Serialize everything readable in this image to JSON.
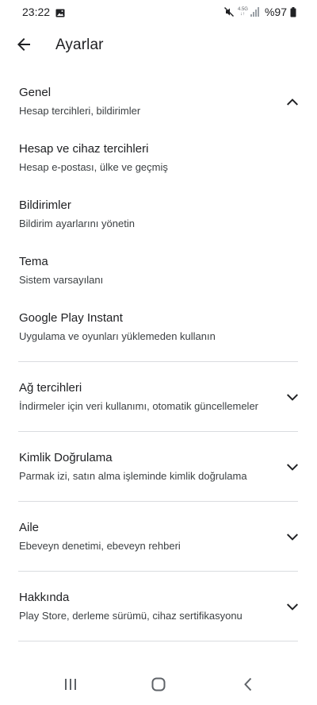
{
  "status_bar": {
    "time": "23:22",
    "network_top": "4.5G",
    "network_bottom": "↓↑",
    "battery": "%97"
  },
  "app_bar": {
    "title": "Ayarlar"
  },
  "settings": [
    {
      "title": "Genel",
      "subtitle": "Hesap tercihleri, bildirimler",
      "expanded": true
    },
    {
      "title": "Hesap ve cihaz tercihleri",
      "subtitle": "Hesap e-postası, ülke ve geçmiş"
    },
    {
      "title": "Bildirimler",
      "subtitle": "Bildirim ayarlarını yönetin"
    },
    {
      "title": "Tema",
      "subtitle": "Sistem varsayılanı"
    },
    {
      "title": "Google Play Instant",
      "subtitle": "Uygulama ve oyunları yüklemeden kullanın"
    },
    {
      "title": "Ağ tercihleri",
      "subtitle": "İndirmeler için veri kullanımı, otomatik güncellemeler",
      "expanded": false
    },
    {
      "title": "Kimlik Doğrulama",
      "subtitle": "Parmak izi, satın alma işleminde kimlik doğrulama",
      "expanded": false
    },
    {
      "title": "Aile",
      "subtitle": "Ebeveyn denetimi, ebeveyn rehberi",
      "expanded": false
    },
    {
      "title": "Hakkında",
      "subtitle": "Play Store, derleme sürümü, cihaz sertifikasyonu",
      "expanded": false
    }
  ],
  "icons": {
    "back": "arrow-back-icon",
    "expand": "chevron-up-icon",
    "collapse": "chevron-down-icon",
    "recents": "recents-icon",
    "home": "home-icon",
    "nav_back": "nav-back-icon"
  },
  "colors": {
    "text_primary": "#202124",
    "text_secondary": "#3c4043",
    "divider": "#dadce0"
  }
}
